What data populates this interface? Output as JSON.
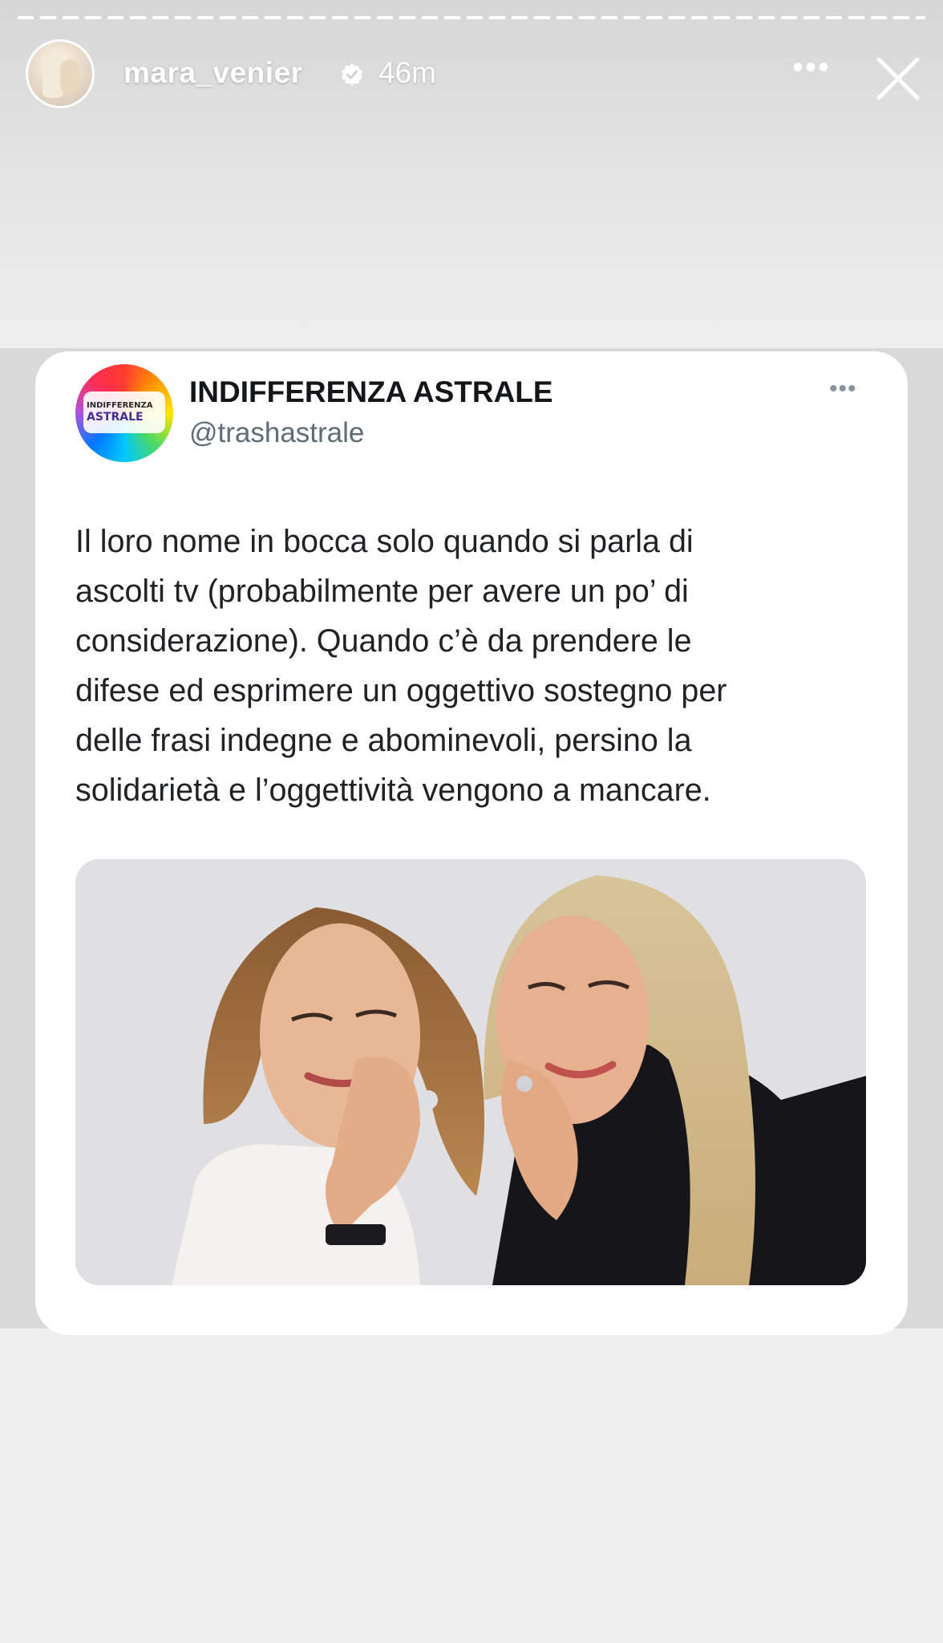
{
  "story": {
    "username": "mara_venier",
    "time": "46m",
    "more_label": "•••",
    "icons": {
      "verified": "verified-badge-icon",
      "more": "more-options-icon",
      "close": "close-icon"
    }
  },
  "post": {
    "account_name": "INDIFFERENZA ASTRALE",
    "handle": "@trashastrale",
    "more_label": "•••",
    "avatar_logo": {
      "line1": "INDIFFERENZA",
      "line2": "ASTRALE"
    },
    "text": "Il loro nome in bocca solo quando si parla di\nascolti tv (probabilmente per avere un po’ di\nconsiderazione). Quando c’è da prendere le\ndifese ed esprimere un oggettivo sostegno per\ndelle frasi indegne e abominevoli, persino la\nsolidarietà e l’oggettività vengono a mancare."
  },
  "colors": {
    "story_top": "#d6d6d6",
    "band": "#d9d9d9",
    "card": "#ffffff",
    "text": "#1f2326",
    "handle": "#5f6c77"
  }
}
